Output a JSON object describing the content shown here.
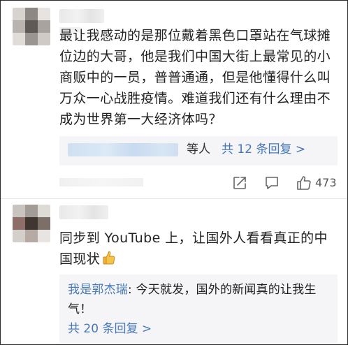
{
  "comments": [
    {
      "text": "最让我感动的是那位戴着黑色口罩站在气球摊位边的大哥，他是我们中国大街上最常见的小商贩中的一员，普普通通，但是他懂得什么叫万众一心战胜疫情。难道我们还有什么理由不成为世界第一大经济体吗？",
      "replies_summary": {
        "suffix": "等人",
        "link": "共 12 条回复 >"
      },
      "actions": {
        "share_icon": "share-icon",
        "comment_icon": "comment-icon",
        "like_icon": "like-icon",
        "like_count": "473"
      }
    },
    {
      "text": "同步到 YouTube 上，让国外人看看真正的中国现状",
      "emoji_icon": "thumbs-up-emoji",
      "top_reply": {
        "author": "我是郭杰瑞",
        "separator": ": ",
        "text": "今天就发，国外的新闻真的让我生气！"
      },
      "more_replies": "共 20 条回复 >"
    }
  ],
  "colors": {
    "link": "#4678b8",
    "text": "#222222",
    "reply_bg": "#f5f5f7",
    "divider": "#e6e6e6"
  }
}
